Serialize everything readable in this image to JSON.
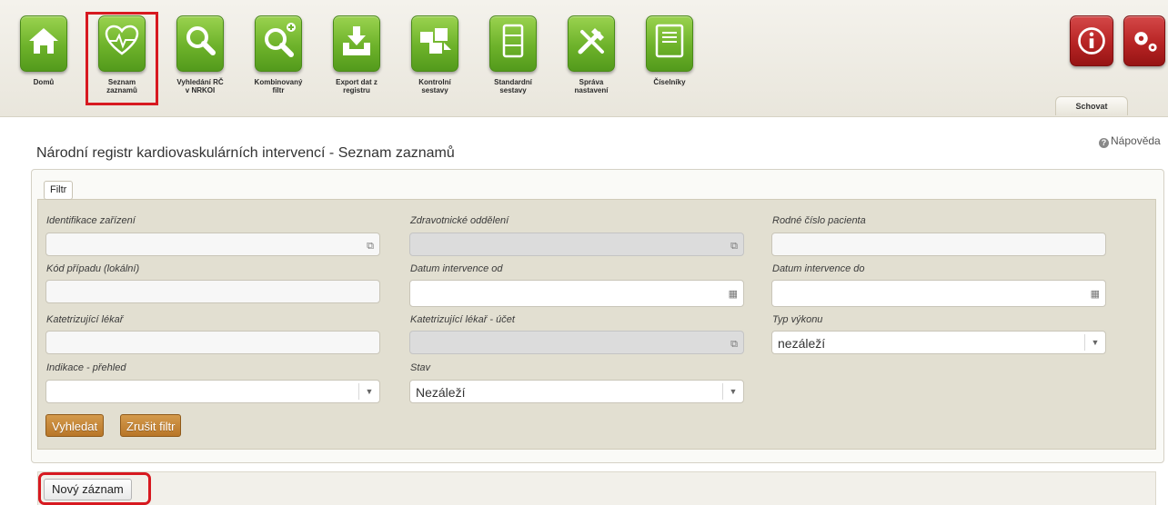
{
  "toolbar": {
    "items": [
      {
        "label": "Domů",
        "icon": "home-icon"
      },
      {
        "label": "Seznam\nzaznamů",
        "icon": "heart-icon"
      },
      {
        "label": "Vyhledání RČ\nv NRKOI",
        "icon": "search-icon"
      },
      {
        "label": "Kombinovaný\nfiltr",
        "icon": "search-plus-icon"
      },
      {
        "label": "Export dat z\nregistru",
        "icon": "export-icon"
      },
      {
        "label": "Kontrolní\nsestavy",
        "icon": "puzzle-icon"
      },
      {
        "label": "Standardní\nsestavy",
        "icon": "report-icon"
      },
      {
        "label": "Správa\nnastavení",
        "icon": "tools-icon"
      },
      {
        "label": "Číselníky",
        "icon": "codebook-icon"
      }
    ],
    "info_icon": "info-icon",
    "settings_icon": "gears-icon",
    "hide_label": "Schovat",
    "accent_color": "#6db22a",
    "highlight_color": "#d71920"
  },
  "header": {
    "title": "Národní registr kardiovaskulárních intervencí - Seznam zaznamů",
    "help_label": "Nápověda"
  },
  "filter": {
    "legend": "Filtr",
    "fields": {
      "facility": {
        "label": "Identifikace zařízení",
        "value": ""
      },
      "department": {
        "label": "Zdravotnické oddělení",
        "value": ""
      },
      "birth_number": {
        "label": "Rodné číslo pacienta",
        "value": ""
      },
      "case_code": {
        "label": "Kód případu (lokální)",
        "value": ""
      },
      "date_from": {
        "label": "Datum intervence od",
        "value": ""
      },
      "date_to": {
        "label": "Datum intervence do",
        "value": ""
      },
      "physician": {
        "label": "Katetrizující lékař",
        "value": ""
      },
      "physician_account": {
        "label": "Katetrizující lékař - účet",
        "value": ""
      },
      "procedure_type": {
        "label": "Typ výkonu",
        "value": "nezáleží"
      },
      "indication": {
        "label": "Indikace - přehled",
        "value": ""
      },
      "status": {
        "label": "Stav",
        "value": "Nezáleží"
      }
    },
    "search_button": "Vyhledat",
    "clear_button": "Zrušit filtr"
  },
  "actions": {
    "new_record": "Nový záznam"
  }
}
